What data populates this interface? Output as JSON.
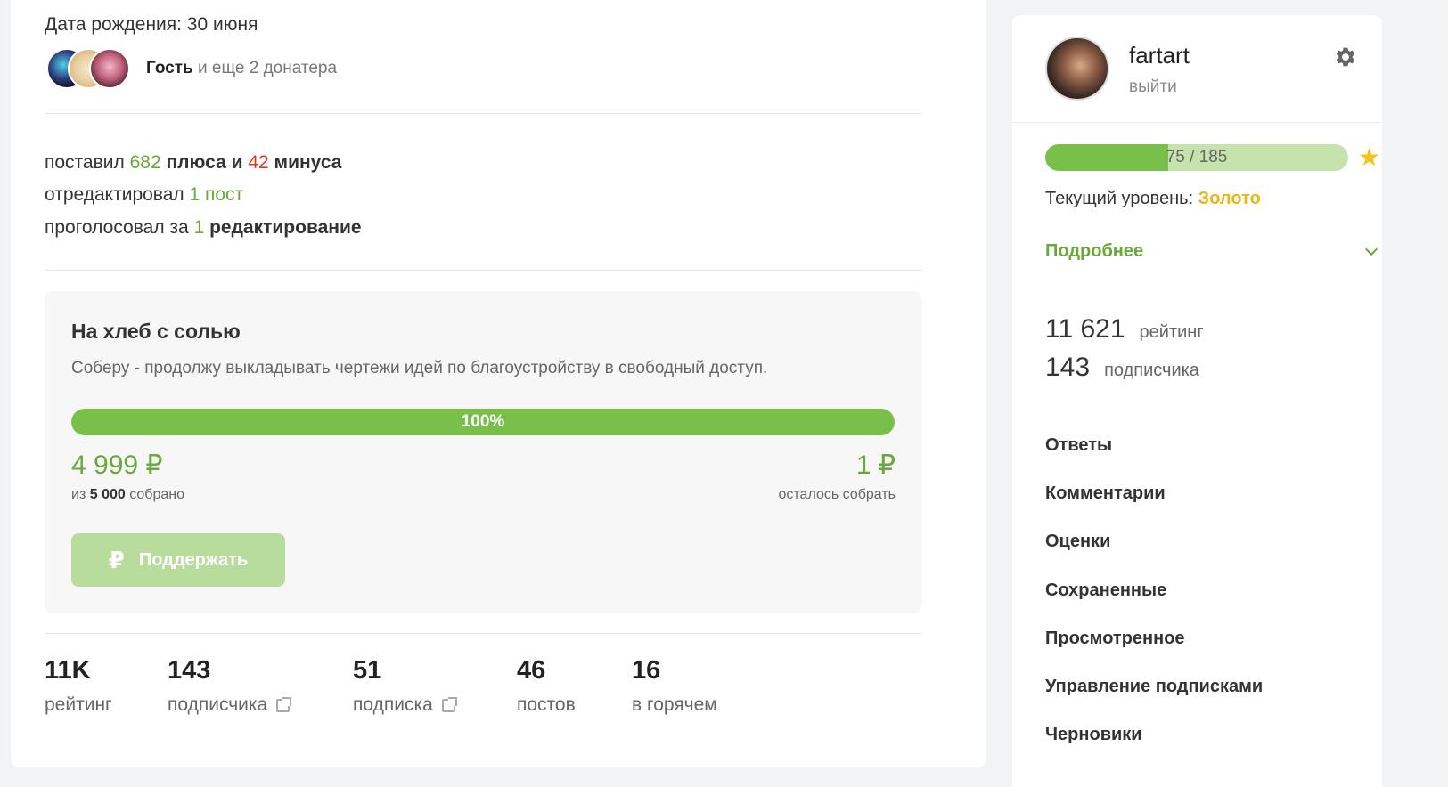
{
  "profile": {
    "birthdate": "Дата рождения: 30 июня",
    "donors": {
      "guest": "Гость",
      "rest": " и еще 2 донатера"
    },
    "activity": {
      "line1_prefix": "поставил ",
      "plus_count": "682",
      "plus_label": " плюса и ",
      "minus_count": "42",
      "minus_label": " минуса",
      "line2_prefix": "отредактировал ",
      "edit_count": "1",
      "edit_label": " пост",
      "line3_prefix": "проголосовал за ",
      "vote_count": "1",
      "vote_label": " редактирование"
    },
    "donation": {
      "title": "На хлеб с солью",
      "description": "Соберу - продолжу выкладывать чертежи идей по благоустройству в свободный доступ.",
      "progress_percent": 100,
      "progress_label": "100%",
      "collected": "4 999 ₽",
      "collected_note_prefix": "из ",
      "goal": "5 000",
      "collected_note_suffix": " собрано",
      "remaining": "1 ₽",
      "remaining_note": "осталось собрать",
      "support_label": "Поддержать",
      "support_icon": "₽"
    },
    "stats": [
      {
        "value": "11K",
        "label": "рейтинг"
      },
      {
        "value": "143",
        "label": "подписчика"
      },
      {
        "value": "51",
        "label": "подписка"
      },
      {
        "value": "46",
        "label": "постов"
      },
      {
        "value": "16",
        "label": "в горячем"
      }
    ]
  },
  "sidebar": {
    "username": "fartart",
    "logout": "выйти",
    "level_progress": {
      "current": 75,
      "max": 185,
      "label": "75 / 185"
    },
    "level_text": "Текущий уровень: ",
    "level_name": "Золото",
    "more_link": "Подробнее",
    "rating_value": "11 621",
    "rating_label": "рейтинг",
    "subscribers_value": "143",
    "subscribers_label": "подписчика",
    "menu": [
      "Ответы",
      "Комментарии",
      "Оценки",
      "Сохраненные",
      "Просмотренное",
      "Управление подписками",
      "Черновики"
    ]
  },
  "colors": {
    "accent_green": "#69a83a",
    "progress_green": "#79c04a",
    "minus_red": "#e0352a",
    "gold": "#e8b81a"
  }
}
